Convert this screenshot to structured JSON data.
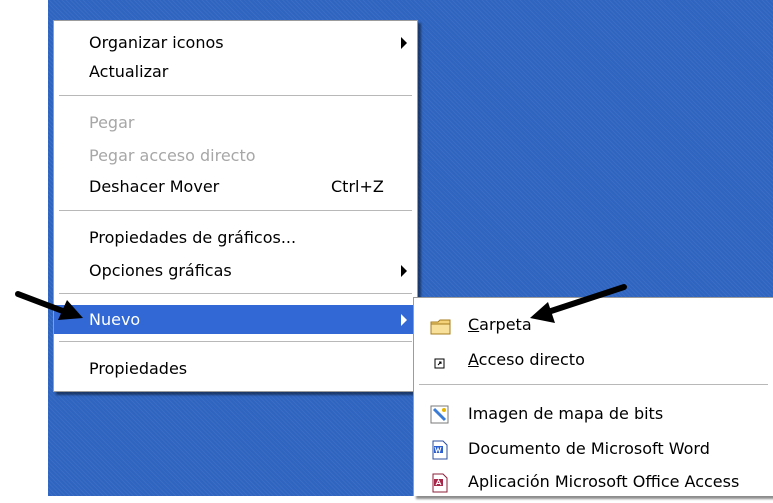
{
  "context_menu": {
    "items": [
      {
        "label": "Organizar iconos",
        "has_submenu": true,
        "enabled": true
      },
      {
        "label": "Actualizar",
        "enabled": true
      },
      {
        "label": "Pegar",
        "enabled": false
      },
      {
        "label": "Pegar acceso directo",
        "enabled": false
      },
      {
        "label": "Deshacer Mover",
        "shortcut": "Ctrl+Z",
        "enabled": true
      },
      {
        "label": "Propiedades de gráficos...",
        "enabled": true
      },
      {
        "label": "Opciones gráficas",
        "has_submenu": true,
        "enabled": true
      },
      {
        "label": "Nuevo",
        "has_submenu": true,
        "enabled": true,
        "highlighted": true
      },
      {
        "label": "Propiedades",
        "enabled": true
      }
    ]
  },
  "submenu_nuevo": {
    "items": [
      {
        "accel": "C",
        "rest": "arpeta",
        "icon": "folder-icon"
      },
      {
        "accel": "A",
        "rest": "cceso directo",
        "icon": "shortcut-icon"
      },
      {
        "label": "Imagen de mapa de bits",
        "icon": "bitmap-image-icon"
      },
      {
        "label": "Documento de Microsoft Word",
        "icon": "word-document-icon"
      },
      {
        "label": "Aplicación Microsoft Office Access",
        "icon": "access-application-icon"
      }
    ]
  },
  "colors": {
    "desktop": "#2f65c0",
    "highlight": "#3168d5",
    "disabled_text": "#a7a7a7"
  }
}
